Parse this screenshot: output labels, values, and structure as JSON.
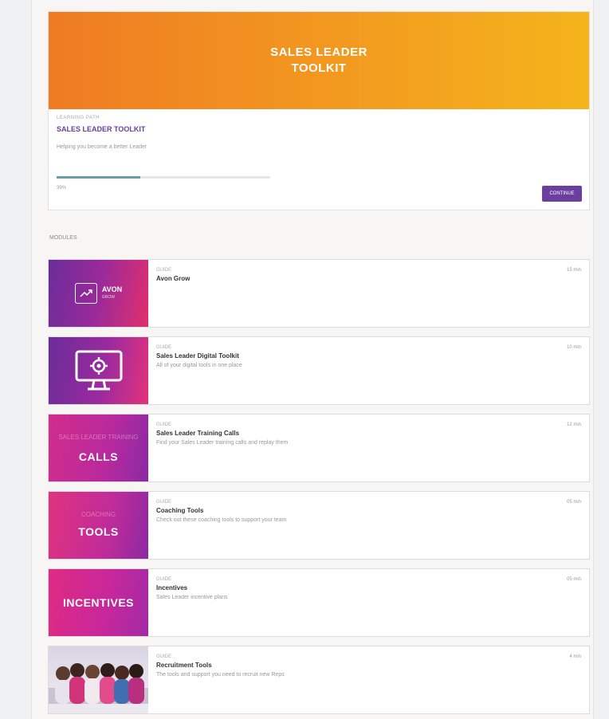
{
  "hero": {
    "banner_line1": "SALES LEADER",
    "banner_line2": "TOOLKIT",
    "eyebrow": "LEARNING PATH",
    "title": "SALES LEADER TOOLKIT",
    "subtitle": "Helping you become a better Leader",
    "progress_percent": 39,
    "progress_text": "39%",
    "button_label": "CONTINUE"
  },
  "section_label": "MODULES",
  "cards": [
    {
      "type": "GUIDE",
      "title": "Avon Grow",
      "desc": "",
      "meta": "15 min",
      "thumb_word": "AVON",
      "thumb_sub": "GROW"
    },
    {
      "type": "GUIDE",
      "title": "Sales Leader Digital Toolkit",
      "desc": "All of your digital tools in one place",
      "meta": "10 min",
      "thumb_word": ""
    },
    {
      "type": "GUIDE",
      "title": "Sales Leader Training Calls",
      "desc": "Find your Sales Leader training calls and replay them",
      "meta": "12 min",
      "thumb_word": "CALLS",
      "thumb_ghost": "SALES LEADER TRAINING"
    },
    {
      "type": "GUIDE",
      "title": "Coaching Tools",
      "desc": "Check out these coaching tools to support your team",
      "meta": "05 min",
      "thumb_word": "TOOLS",
      "thumb_ghost": "COACHING"
    },
    {
      "type": "GUIDE",
      "title": "Incentives",
      "desc": "Sales Leader incentive plans",
      "meta": "05 min",
      "thumb_word": "INCENTIVES"
    },
    {
      "type": "GUIDE",
      "title": "Recruitment Tools",
      "desc": "The tools and support you need to recruit new Reps",
      "meta": "4 min",
      "thumb_word": ""
    }
  ],
  "colors": {
    "accent": "#6b3fa0",
    "hero_gradient_start": "#ef7b22",
    "hero_gradient_end": "#f5b41b",
    "progress": "#6b9aa0"
  },
  "icons": {
    "card2": "monitor-gear-icon",
    "card6": "team-photo"
  }
}
